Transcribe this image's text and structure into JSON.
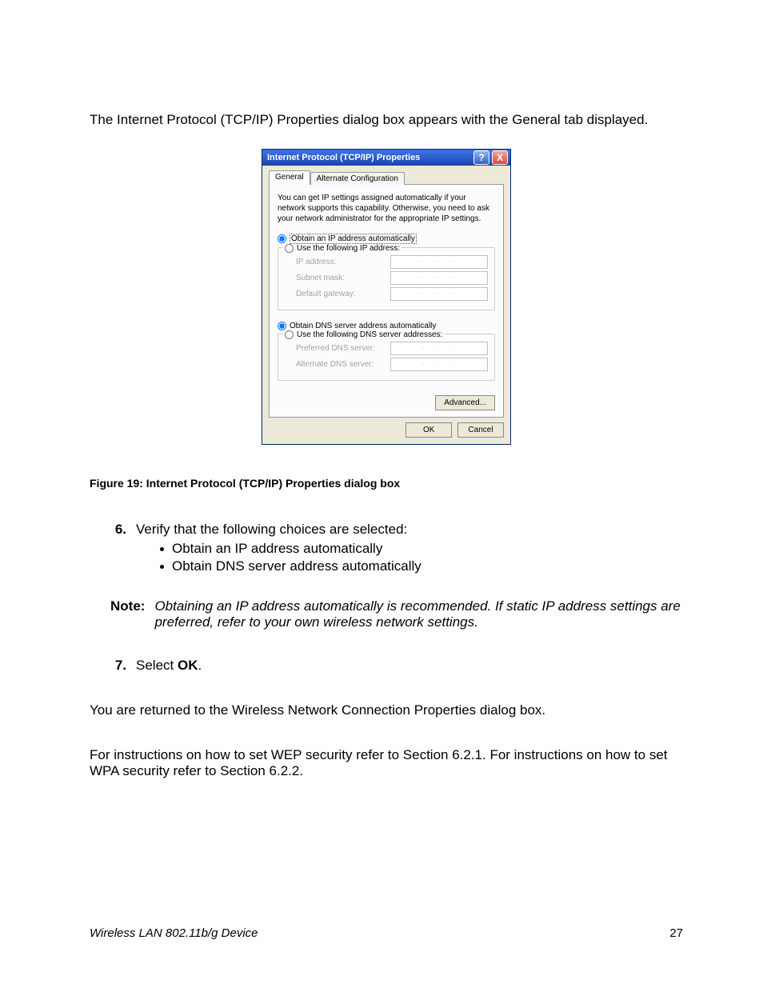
{
  "intro": "The Internet Protocol (TCP/IP) Properties dialog box appears with the General tab displayed.",
  "dialog": {
    "title": "Internet Protocol (TCP/IP) Properties",
    "help": "?",
    "close": "X",
    "tabs": {
      "general": "General",
      "alt": "Alternate Configuration"
    },
    "desc": "You can get IP settings assigned automatically if your network supports this capability. Otherwise, you need to ask your network administrator for the appropriate IP settings.",
    "r_obtain_ip": "Obtain an IP address automatically",
    "r_use_ip": "Use the following IP address:",
    "lbl_ip": "IP address:",
    "lbl_subnet": "Subnet mask:",
    "lbl_gw": "Default gateway:",
    "r_obtain_dns": "Obtain DNS server address automatically",
    "r_use_dns": "Use the following DNS server addresses:",
    "lbl_pdns": "Preferred DNS server:",
    "lbl_adns": "Alternate DNS server:",
    "btn_adv": "Advanced...",
    "btn_ok": "OK",
    "btn_cancel": "Cancel",
    "dots": ".   .   ."
  },
  "caption": "Figure 19: Internet Protocol (TCP/IP) Properties dialog box",
  "step6_num": "6.",
  "step6": "Verify that the following choices are selected:",
  "step6_b1": "Obtain an IP address automatically",
  "step6_b2": "Obtain DNS server address automatically",
  "note_label": "Note:",
  "note_text": "Obtaining an IP address automatically is recommended.  If static IP address settings are preferred, refer to your own wireless network settings.",
  "step7_num": "7.",
  "step7_a": "Select ",
  "step7_b": "OK",
  "step7_c": ".",
  "para1": "You are returned to the Wireless Network Connection Properties dialog box.",
  "para2": "For instructions on how to set WEP security refer to Section 6.2.1.  For instructions on how to set WPA security refer to Section 6.2.2.",
  "footer_left": "Wireless LAN 802.11b/g Device",
  "footer_right": "27"
}
